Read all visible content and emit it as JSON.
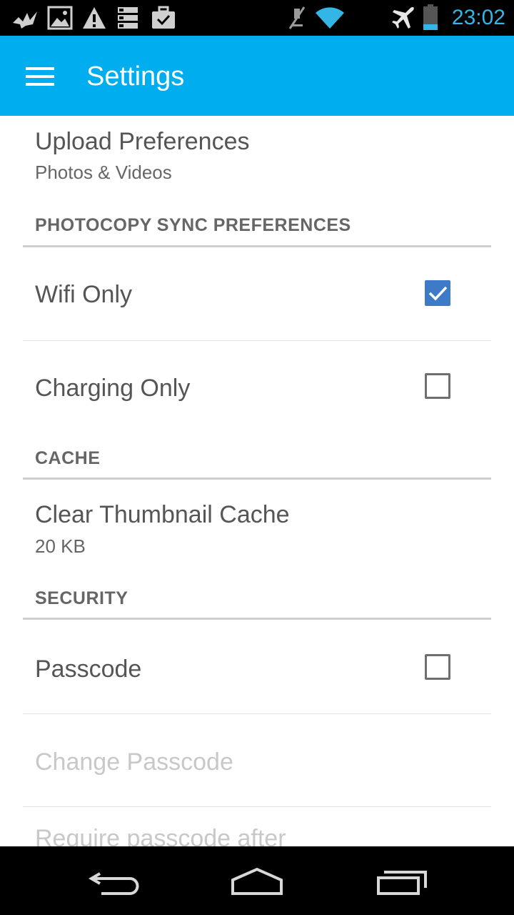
{
  "status_bar": {
    "time": "23:02",
    "left_icons": [
      "bird-notification-icon",
      "image-icon",
      "warning-icon",
      "storage-icon",
      "briefcase-icon"
    ],
    "right_icons": [
      "mute-icon",
      "wifi-icon",
      "airplane-mode-icon",
      "battery-icon"
    ],
    "accent": "#33b5e5"
  },
  "app_bar": {
    "title": "Settings",
    "color": "#00aeef"
  },
  "settings": {
    "upload": {
      "title": "Upload Preferences",
      "summary": "Photos & Videos"
    },
    "sync_category": "PHOTOCOPY SYNC PREFERENCES",
    "wifi_only": {
      "label": "Wifi Only",
      "checked": true
    },
    "charging_only": {
      "label": "Charging Only",
      "checked": false
    },
    "cache_category": "CACHE",
    "clear_cache": {
      "title": "Clear Thumbnail Cache",
      "summary": "20 KB"
    },
    "security_category": "SECURITY",
    "passcode": {
      "label": "Passcode",
      "checked": false
    },
    "change_passcode": {
      "label": "Change Passcode",
      "enabled": false
    },
    "require_passcode": {
      "label": "Require passcode after",
      "enabled": false
    }
  },
  "nav_bar": {
    "buttons": [
      "back-icon",
      "home-icon",
      "recent-apps-icon"
    ]
  },
  "colors": {
    "checkbox_checked": "#3d7ac7",
    "text_primary": "#555555",
    "text_disabled": "#c8c8c8"
  }
}
